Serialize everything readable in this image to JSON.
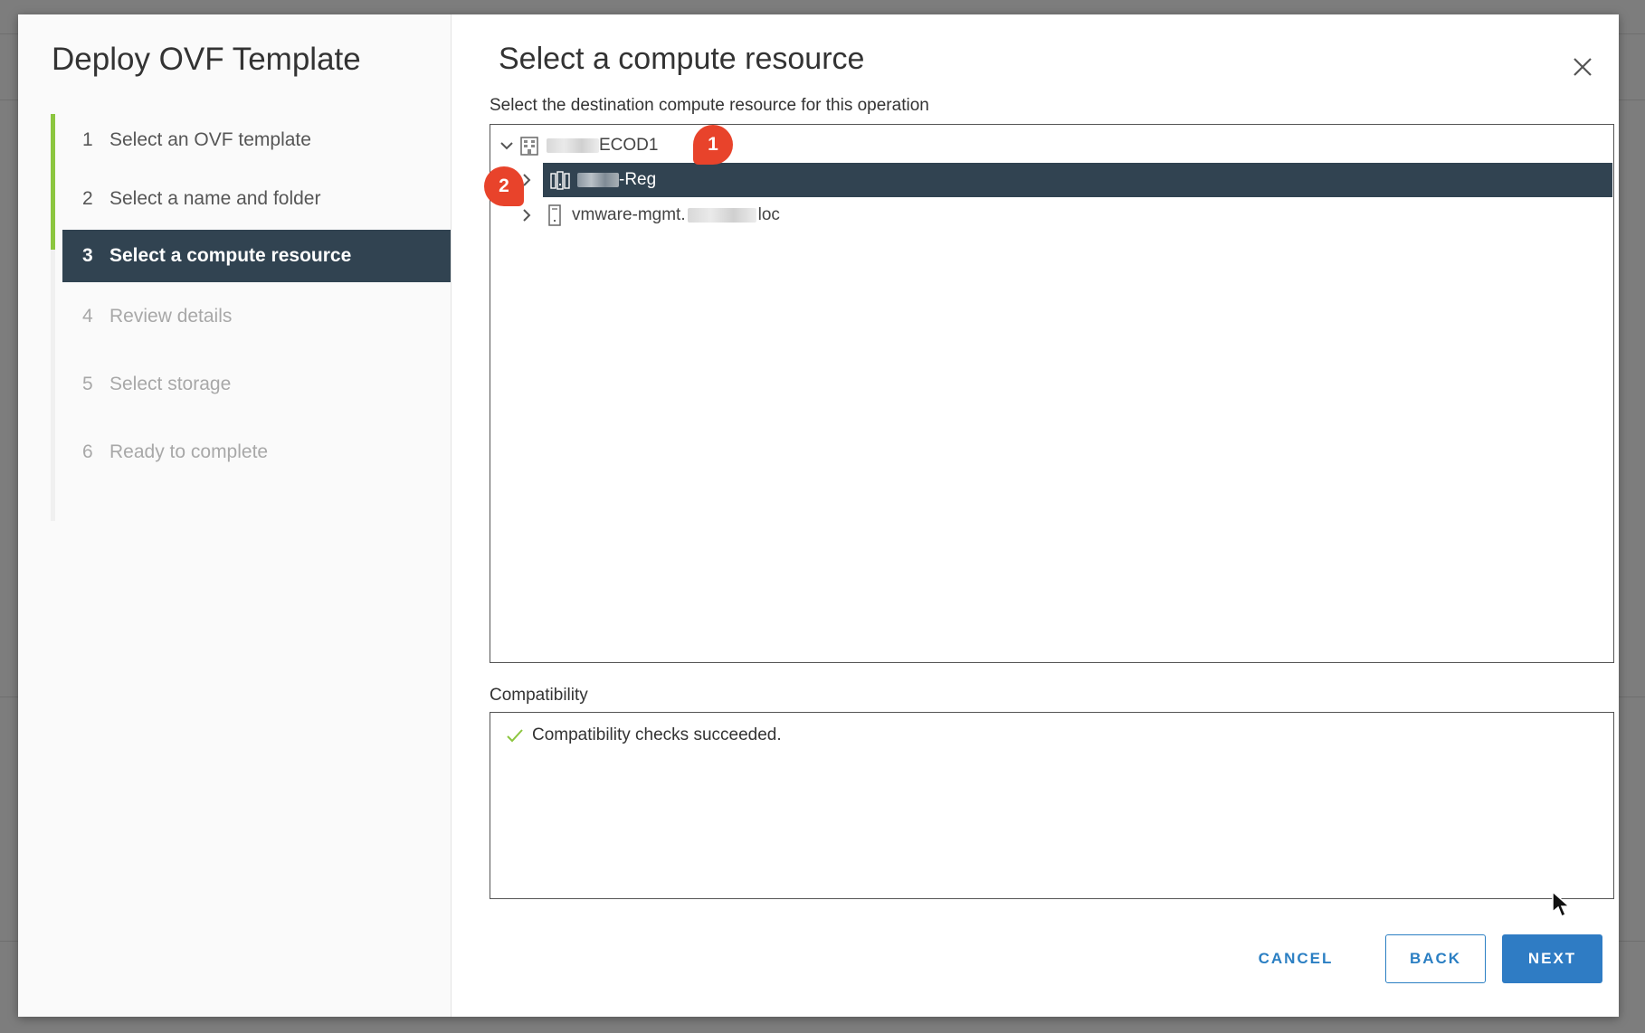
{
  "wizard": {
    "title": "Deploy OVF Template",
    "steps": [
      {
        "num": "1",
        "label": "Select an OVF template",
        "state": "completed"
      },
      {
        "num": "2",
        "label": "Select a name and folder",
        "state": "completed"
      },
      {
        "num": "3",
        "label": "Select a compute resource",
        "state": "active"
      },
      {
        "num": "4",
        "label": "Review details",
        "state": "disabled"
      },
      {
        "num": "5",
        "label": "Select storage",
        "state": "disabled"
      },
      {
        "num": "6",
        "label": "Ready to complete",
        "state": "disabled"
      }
    ]
  },
  "content": {
    "title": "Select a compute resource",
    "subtitle": "Select the destination compute resource for this operation",
    "tree": [
      {
        "label": "ECOD1",
        "icon": "datacenter-icon",
        "expanded": true
      },
      {
        "label": "-Reg",
        "icon": "cluster-icon",
        "expanded": false,
        "selected": true
      },
      {
        "label_prefix": "vmware-mgmt.",
        "label_suffix": "loc",
        "icon": "host-icon",
        "expanded": false
      }
    ],
    "compatibility": {
      "label": "Compatibility",
      "message": "Compatibility checks succeeded."
    }
  },
  "buttons": {
    "cancel": "CANCEL",
    "back": "BACK",
    "next": "NEXT"
  },
  "callouts": [
    "1",
    "2"
  ],
  "colors": {
    "accent": "#2f7cc4",
    "selected_bg": "#314351",
    "completed_bar": "#8cc63f",
    "callout": "#e8432b",
    "success": "#8cc63f"
  }
}
